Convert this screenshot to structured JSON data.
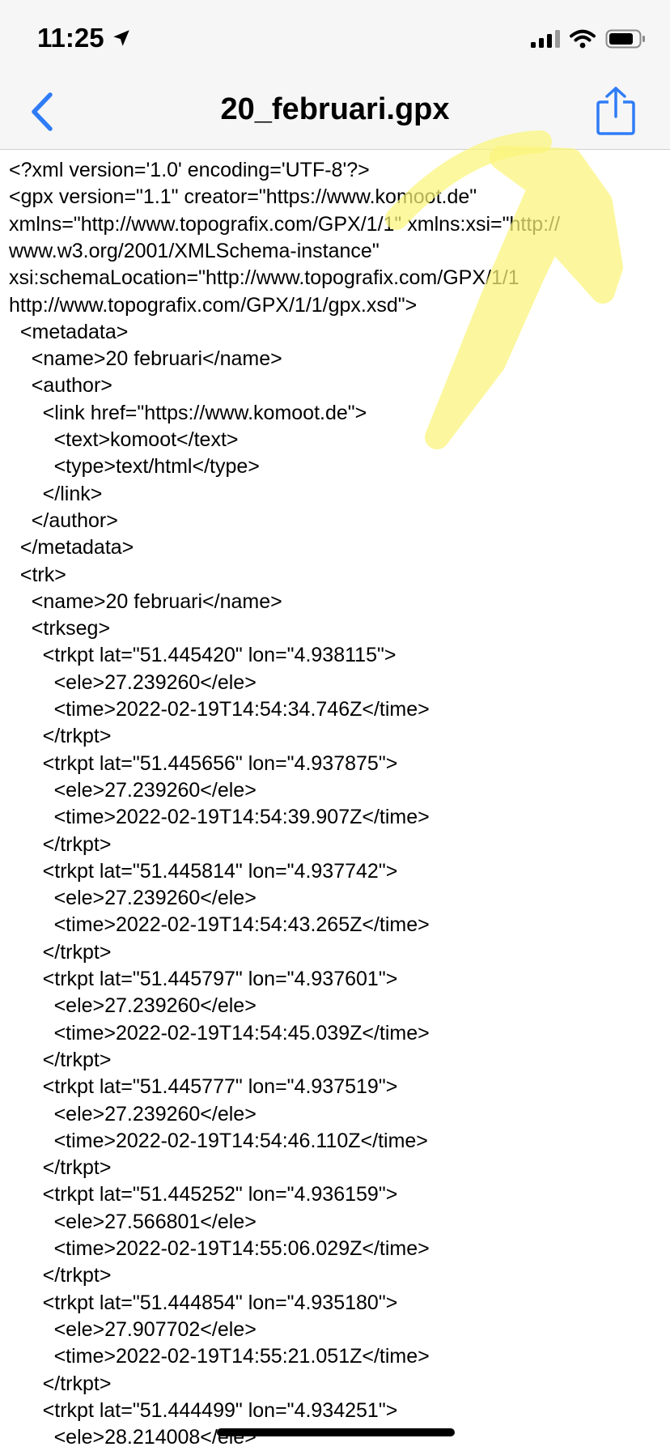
{
  "status_bar": {
    "time": "11:25",
    "icons": [
      "location-arrow-icon",
      "cellular-signal-icon",
      "wifi-icon",
      "battery-icon"
    ]
  },
  "nav": {
    "title": "20_februari.gpx",
    "back_icon": "chevron-left-icon",
    "share_icon": "share-icon"
  },
  "file_lines": [
    "<?xml version='1.0' encoding='UTF-8'?>",
    "<gpx version=\"1.1\" creator=\"https://www.komoot.de\"",
    "xmlns=\"http://www.topografix.com/GPX/1/1\" xmlns:xsi=\"http://",
    "www.w3.org/2001/XMLSchema-instance\"",
    "xsi:schemaLocation=\"http://www.topografix.com/GPX/1/1",
    "http://www.topografix.com/GPX/1/1/gpx.xsd\">",
    "  <metadata>",
    "    <name>20 februari</name>",
    "    <author>",
    "      <link href=\"https://www.komoot.de\">",
    "        <text>komoot</text>",
    "        <type>text/html</type>",
    "      </link>",
    "    </author>",
    "  </metadata>",
    "  <trk>",
    "    <name>20 februari</name>",
    "    <trkseg>",
    "      <trkpt lat=\"51.445420\" lon=\"4.938115\">",
    "        <ele>27.239260</ele>",
    "        <time>2022-02-19T14:54:34.746Z</time>",
    "      </trkpt>",
    "      <trkpt lat=\"51.445656\" lon=\"4.937875\">",
    "        <ele>27.239260</ele>",
    "        <time>2022-02-19T14:54:39.907Z</time>",
    "      </trkpt>",
    "      <trkpt lat=\"51.445814\" lon=\"4.937742\">",
    "        <ele>27.239260</ele>",
    "        <time>2022-02-19T14:54:43.265Z</time>",
    "      </trkpt>",
    "      <trkpt lat=\"51.445797\" lon=\"4.937601\">",
    "        <ele>27.239260</ele>",
    "        <time>2022-02-19T14:54:45.039Z</time>",
    "      </trkpt>",
    "      <trkpt lat=\"51.445777\" lon=\"4.937519\">",
    "        <ele>27.239260</ele>",
    "        <time>2022-02-19T14:54:46.110Z</time>",
    "      </trkpt>",
    "      <trkpt lat=\"51.445252\" lon=\"4.936159\">",
    "        <ele>27.566801</ele>",
    "        <time>2022-02-19T14:55:06.029Z</time>",
    "      </trkpt>",
    "      <trkpt lat=\"51.444854\" lon=\"4.935180\">",
    "        <ele>27.907702</ele>",
    "        <time>2022-02-19T14:55:21.051Z</time>",
    "      </trkpt>",
    "      <trkpt lat=\"51.444499\" lon=\"4.934251\">",
    "        <ele>28.214008</ele>"
  ],
  "colors": {
    "accent": "#2f7cf6",
    "highlight": "#fbf57a"
  }
}
